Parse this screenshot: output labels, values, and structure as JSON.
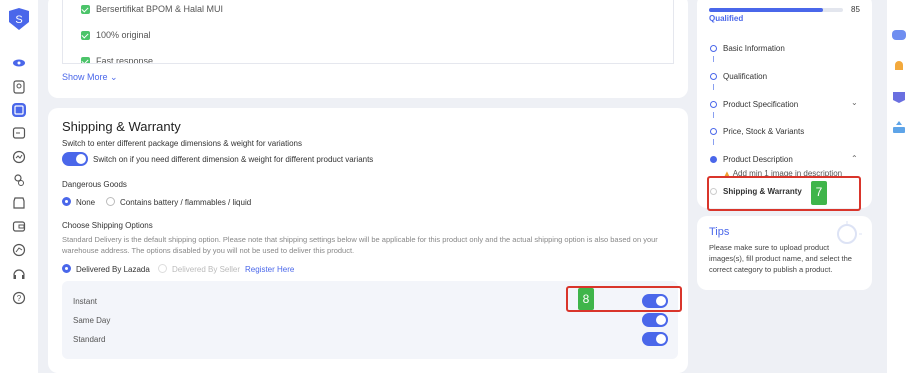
{
  "sidebar": {
    "icons": [
      "logo-icon",
      "eye-icon",
      "product-icon",
      "orders-icon",
      "marketing-icon",
      "chart-icon",
      "finance-icon",
      "store-icon",
      "wallet-icon",
      "growth-icon",
      "support-icon",
      "help-icon"
    ]
  },
  "product_highlights": {
    "items": [
      "Bersertifikat BPOM & Halal MUI",
      "100% original",
      "Fast response"
    ],
    "show_more": "Show More"
  },
  "shipping": {
    "title": "Shipping & Warranty",
    "variation_switch_label": "Switch to enter different package dimensions & weight for variations",
    "variation_switch_text": "Switch on if you need different dimension & weight for different product variants",
    "dangerous_goods_label": "Dangerous Goods",
    "dg_none": "None",
    "dg_contains": "Contains battery / flammables / liquid",
    "choose_options_label": "Choose Shipping Options",
    "options_note": "Standard Delivery is the default shipping option. Please note that shipping settings below will be applicable for this product only and the actual shipping option is also based on your warehouse address. The options disabled by you will not be used to deliver this product.",
    "delivered_by_lazada": "Delivered By Lazada",
    "delivered_by_seller": "Delivered By Seller",
    "register_here": "Register Here",
    "methods": [
      {
        "label": "Instant",
        "enabled": true
      },
      {
        "label": "Same Day",
        "enabled": true
      },
      {
        "label": "Standard",
        "enabled": true
      }
    ]
  },
  "progress": {
    "status": "Qualified",
    "score": "85",
    "score_fraction": 0.85,
    "steps": [
      "Basic Information",
      "Qualification",
      "Product Specification",
      "Price, Stock & Variants",
      "Product Description",
      "Shipping & Warranty"
    ],
    "warning": "Add min 1 image in description"
  },
  "tips": {
    "title": "Tips",
    "text": "Please make sure to upload product images(s), fill product name, and select the correct category to publish a product."
  },
  "annotations": {
    "seven": "7",
    "eight": "8"
  },
  "colors": {
    "accent": "#4a67ea",
    "check": "#4cc46a",
    "annotation": "#d9352b",
    "badge": "#3fb54a"
  }
}
